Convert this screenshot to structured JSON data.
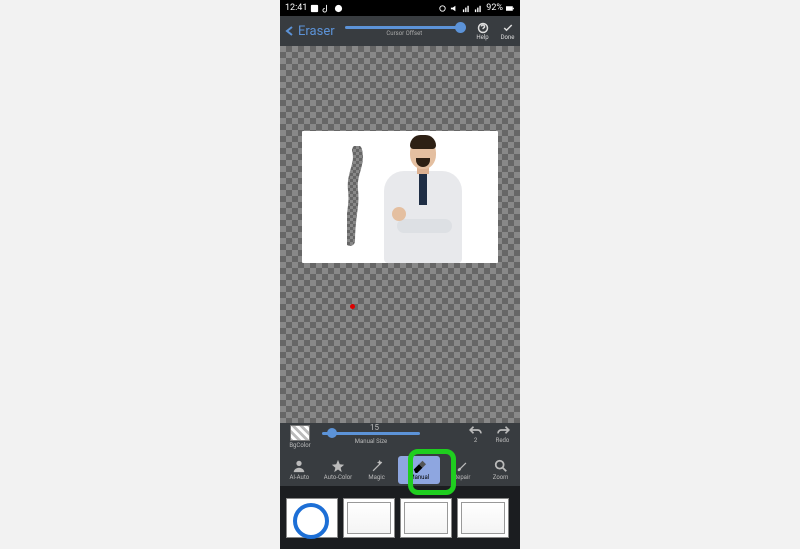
{
  "status": {
    "time": "12:41",
    "battery": "92%"
  },
  "header": {
    "back_label": "Eraser",
    "slider_label": "Cursor Offset",
    "help_label": "Help",
    "done_label": "Done"
  },
  "midbar": {
    "bgcolor_label": "BgColor",
    "size_value": "15",
    "size_label": "Manual Size",
    "undo_count": "2",
    "redo_label": "Redo"
  },
  "tools": {
    "ai_auto": "AI-Auto",
    "auto_color": "Auto-Color",
    "magic": "Magic",
    "manual": "Manual",
    "repair": "Repair",
    "zoom": "Zoom"
  }
}
